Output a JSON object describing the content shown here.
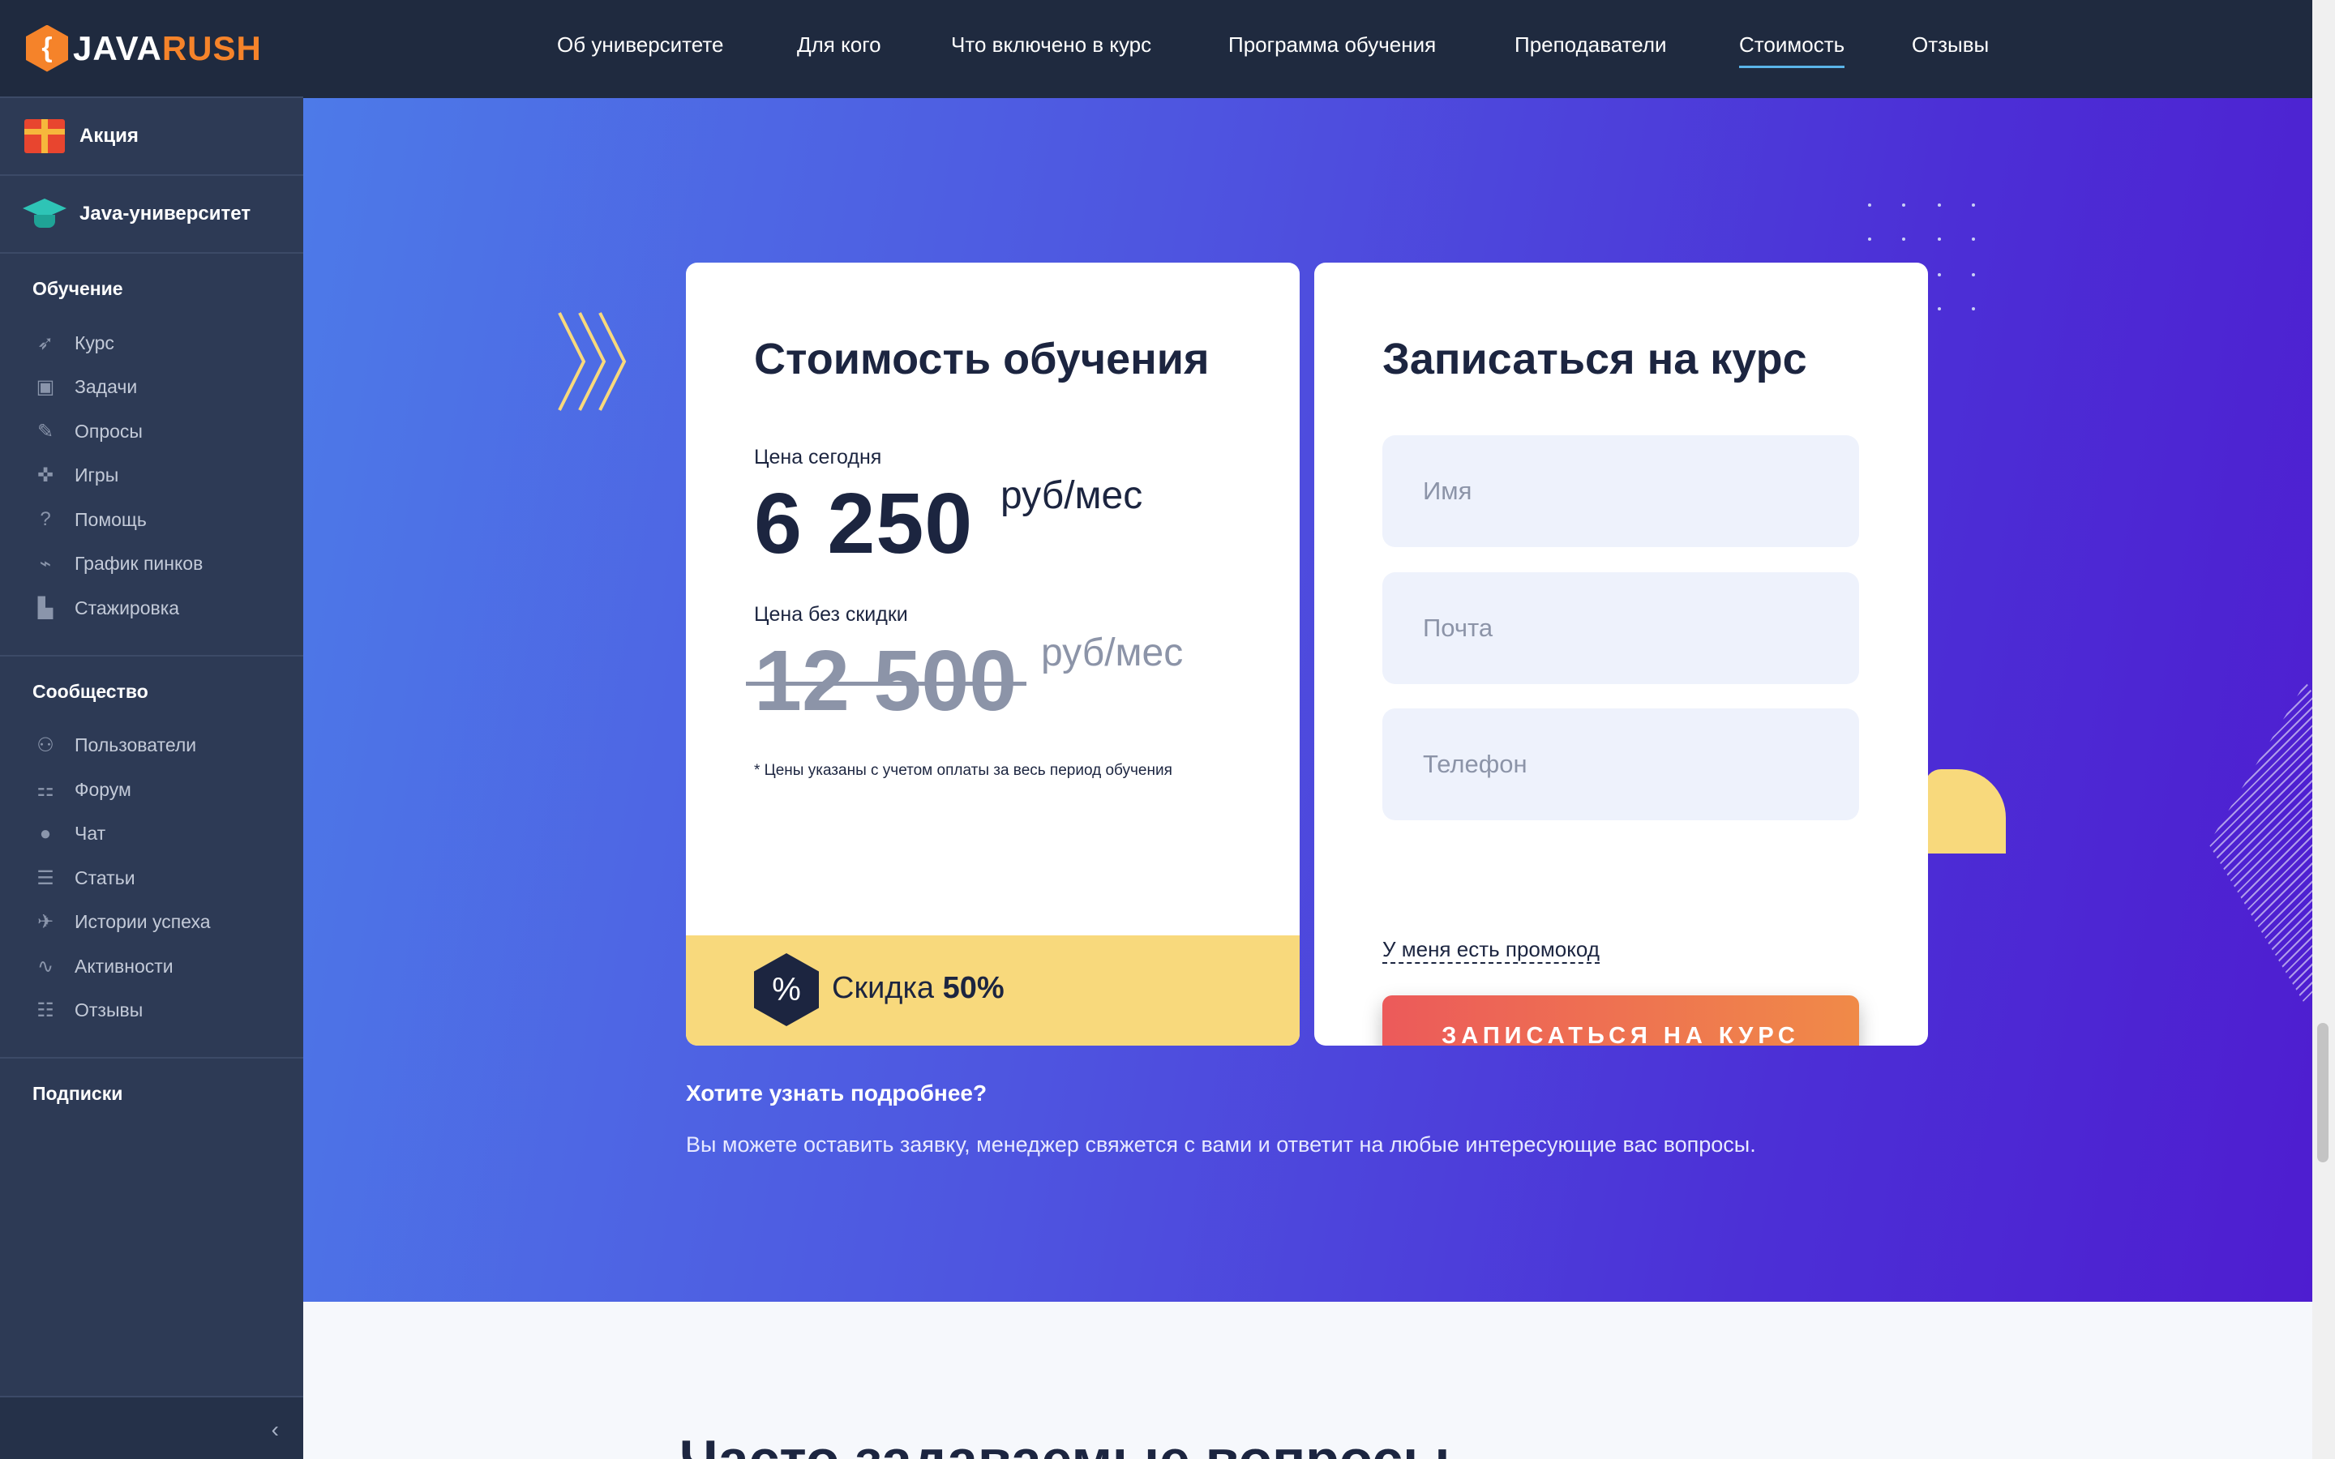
{
  "brand": {
    "logo_mark": "{",
    "java": "JAVA",
    "rush": "RUSH"
  },
  "sidebar": {
    "promo": [
      {
        "label": "Акция",
        "icon": "gift-icon"
      },
      {
        "label": "Java-университет",
        "icon": "graduation-cap-icon"
      }
    ],
    "sections": [
      {
        "title": "Обучение",
        "items": [
          {
            "label": "Курс",
            "icon": "rocket-icon",
            "glyph": "➶"
          },
          {
            "label": "Задачи",
            "icon": "tasks-icon",
            "glyph": "▣"
          },
          {
            "label": "Опросы",
            "icon": "survey-icon",
            "glyph": "✎"
          },
          {
            "label": "Игры",
            "icon": "gamepad-icon",
            "glyph": "✜"
          },
          {
            "label": "Помощь",
            "icon": "help-icon",
            "glyph": "?"
          },
          {
            "label": "График пинков",
            "icon": "kick-schedule-icon",
            "glyph": "⌁"
          },
          {
            "label": "Стажировка",
            "icon": "internship-icon",
            "glyph": "▙"
          }
        ]
      },
      {
        "title": "Сообщество",
        "items": [
          {
            "label": "Пользователи",
            "icon": "users-icon",
            "glyph": "⚇"
          },
          {
            "label": "Форум",
            "icon": "forum-icon",
            "glyph": "⚏"
          },
          {
            "label": "Чат",
            "icon": "chat-icon",
            "glyph": "●"
          },
          {
            "label": "Статьи",
            "icon": "articles-icon",
            "glyph": "☰"
          },
          {
            "label": "Истории успеха",
            "icon": "success-stories-icon",
            "glyph": "✈"
          },
          {
            "label": "Активности",
            "icon": "activity-icon",
            "glyph": "∿"
          },
          {
            "label": "Отзывы",
            "icon": "reviews-icon",
            "glyph": "☷"
          }
        ]
      },
      {
        "title": "Подписки",
        "items": []
      }
    ],
    "collapse_glyph": "‹"
  },
  "topnav": {
    "items": [
      {
        "label": "Об университете",
        "active": false
      },
      {
        "label": "Для кого",
        "active": false
      },
      {
        "label": "Что включено в курс",
        "active": false
      },
      {
        "label": "Программа обучения",
        "active": false
      },
      {
        "label": "Преподаватели",
        "active": false
      },
      {
        "label": "Стоимость",
        "active": true
      },
      {
        "label": "Отзывы",
        "active": false
      }
    ]
  },
  "pricing": {
    "title": "Стоимость обучения",
    "today_label": "Цена сегодня",
    "today_price": "6 250",
    "unit": "руб/мес",
    "old_label": "Цена без скидки",
    "old_price": "12 500",
    "note": "* Цены указаны с учетом оплаты за весь период обучения",
    "discount_label": "Скидка",
    "discount_value": "50%",
    "discount_glyph": "%"
  },
  "signup": {
    "title": "Записаться на курс",
    "name_placeholder": "Имя",
    "email_placeholder": "Почта",
    "phone_placeholder": "Телефон",
    "promo_link": "У меня есть промокод",
    "submit": "ЗАПИСАТЬСЯ НА КУРС"
  },
  "info": {
    "question": "Хотите узнать подробнее?",
    "text": "Вы можете оставить заявку, менеджер свяжется с вами и ответит на любые интересующие вас вопросы."
  },
  "faq": {
    "title": "Часто задаваемые вопросы"
  },
  "colors": {
    "sidebar_bg": "#2d3a55",
    "topbar_bg": "#1f2a3f",
    "accent_orange": "#f5832a",
    "discount_yellow": "#f8d97c",
    "cta_start": "#ec5a5a",
    "cta_end": "#f08a48"
  }
}
